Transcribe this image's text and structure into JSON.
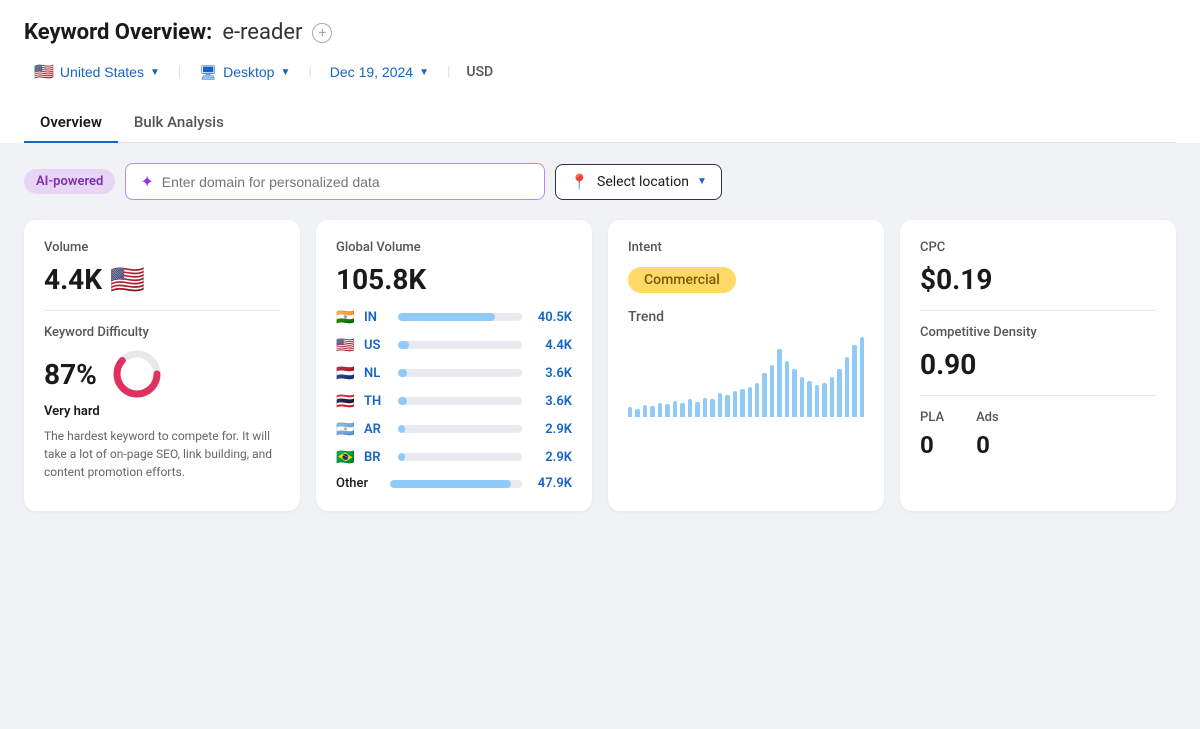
{
  "header": {
    "title": "Keyword Overview:",
    "keyword": "e-reader",
    "add_button_label": "+",
    "location": "United States",
    "device": "Desktop",
    "date": "Dec 19, 2024",
    "currency": "USD"
  },
  "tabs": [
    {
      "label": "Overview",
      "active": true
    },
    {
      "label": "Bulk Analysis",
      "active": false
    }
  ],
  "ai_bar": {
    "badge": "AI-powered",
    "domain_placeholder": "Enter domain for personalized data",
    "location_placeholder": "Select location"
  },
  "volume_card": {
    "label": "Volume",
    "value": "4.4K",
    "flag": "🇺🇸"
  },
  "difficulty_card": {
    "label": "Keyword Difficulty",
    "value": "87%",
    "rating": "Very hard",
    "description": "The hardest keyword to compete for. It will take a lot of on-page SEO, link building, and content promotion efforts.",
    "ring_pct": 87
  },
  "global_volume_card": {
    "label": "Global Volume",
    "value": "105.8K",
    "countries": [
      {
        "flag": "🇮🇳",
        "code": "IN",
        "value": "40.5K",
        "pct": 78
      },
      {
        "flag": "🇺🇸",
        "code": "US",
        "value": "4.4K",
        "pct": 9
      },
      {
        "flag": "🇳🇱",
        "code": "NL",
        "value": "3.6K",
        "pct": 7
      },
      {
        "flag": "🇹🇭",
        "code": "TH",
        "value": "3.6K",
        "pct": 7
      },
      {
        "flag": "🇦🇷",
        "code": "AR",
        "value": "2.9K",
        "pct": 6
      },
      {
        "flag": "🇧🇷",
        "code": "BR",
        "value": "2.9K",
        "pct": 6
      }
    ],
    "other_label": "Other",
    "other_value": "47.9K",
    "other_pct": 92
  },
  "intent_card": {
    "label": "Intent",
    "intent": "Commercial",
    "trend_label": "Trend",
    "trend_bars": [
      12,
      10,
      15,
      14,
      18,
      16,
      20,
      18,
      22,
      19,
      24,
      22,
      30,
      28,
      32,
      35,
      38,
      42,
      55,
      65,
      85,
      70,
      60,
      50,
      45,
      40,
      42,
      50,
      60,
      75,
      90,
      100
    ]
  },
  "cpc_card": {
    "cpc_label": "CPC",
    "cpc_value": "$0.19",
    "comp_label": "Competitive Density",
    "comp_value": "0.90",
    "pla_label": "PLA",
    "pla_value": "0",
    "ads_label": "Ads",
    "ads_value": "0"
  }
}
